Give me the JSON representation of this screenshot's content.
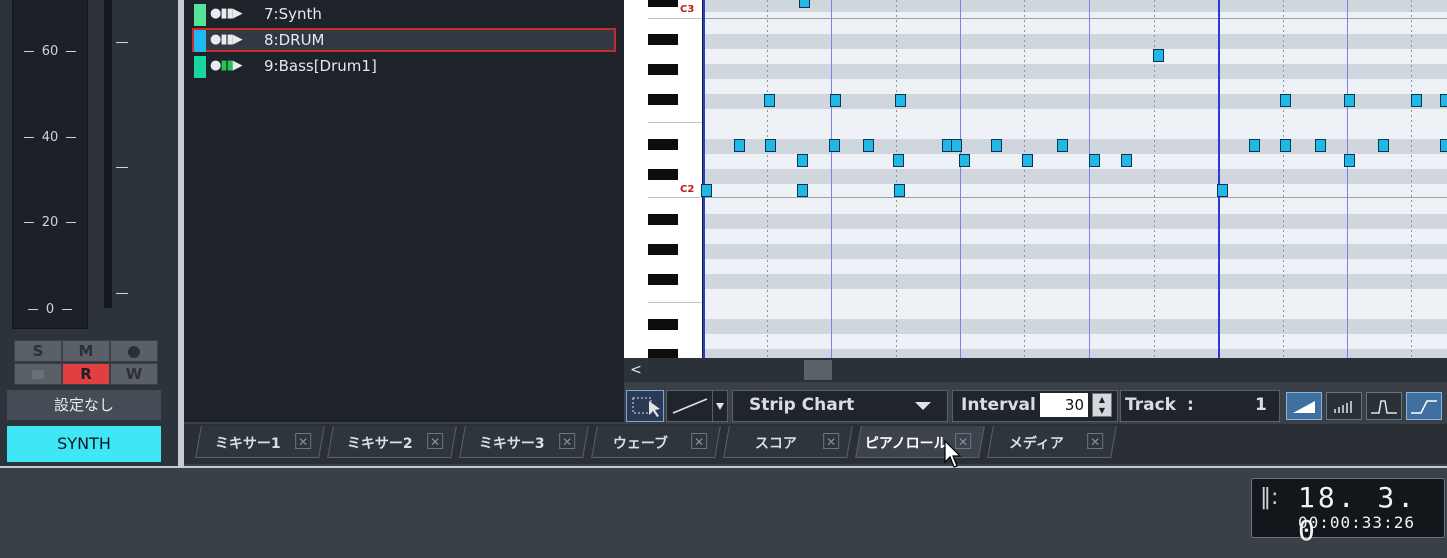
{
  "mixer": {
    "meter_labels": [
      "60",
      "40",
      "20",
      "0"
    ],
    "buttons": {
      "solo": "S",
      "mute": "M",
      "rec": "R",
      "write": "W"
    },
    "preset": "設定なし",
    "channel_name": "SYNTH",
    "colors": {
      "channel_accent": "#3ee6f6",
      "record_active": "#e04040"
    }
  },
  "tracks": [
    {
      "name": "7:Synth",
      "color": "#55e39a"
    },
    {
      "name": "8:DRUM",
      "color": "#1fb8f0",
      "selected": true
    },
    {
      "name": "9:Bass[Drum1]",
      "color": "#19d6a0"
    }
  ],
  "piano_roll": {
    "note_labels": {
      "c3": "C3",
      "c2": "C2"
    },
    "note_color": "#21b7e8",
    "scroll_left_arrow": "<"
  },
  "toolbar": {
    "draw_mode": "Strip Chart",
    "interval_label": "Interval",
    "interval_value": "30",
    "track_label": "Track",
    "track_separator": ":",
    "track_value": "1"
  },
  "tabs": [
    {
      "label": "ミキサー1",
      "active": false
    },
    {
      "label": "ミキサー2",
      "active": false
    },
    {
      "label": "ミキサー3",
      "active": false
    },
    {
      "label": "ウェーブ",
      "active": false
    },
    {
      "label": "スコア",
      "active": false
    },
    {
      "label": "ピアノロール",
      "active": true
    },
    {
      "label": "メディア",
      "active": false
    }
  ],
  "counter": {
    "position": "18. 3.   0",
    "time": "00:00:33:26"
  }
}
